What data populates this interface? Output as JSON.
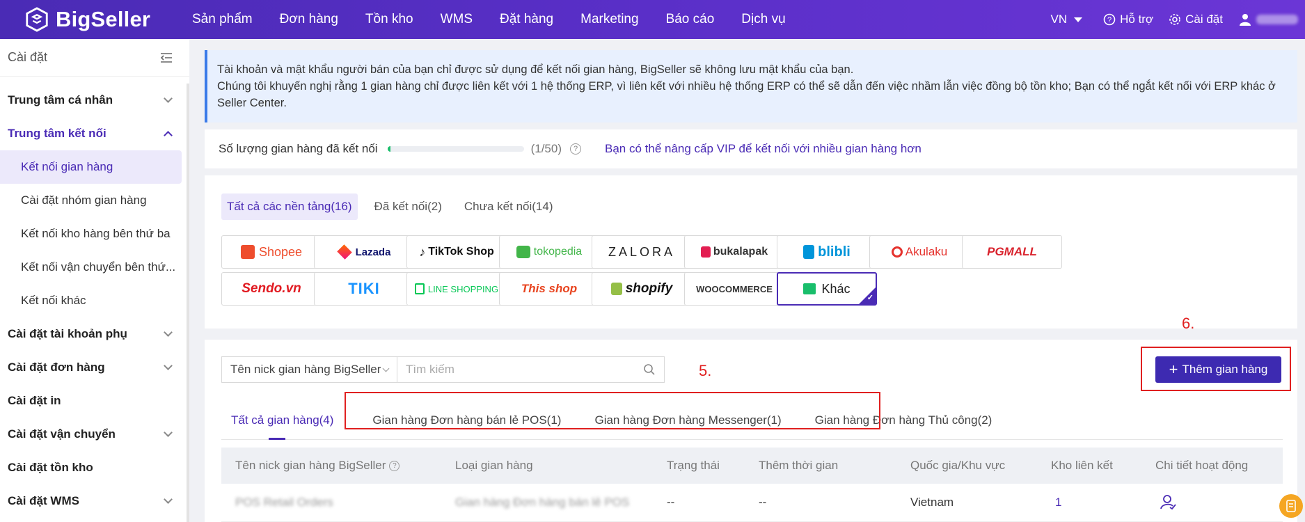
{
  "app": {
    "brand": "BigSeller",
    "accent": "#4a2bb5"
  },
  "nav": [
    "Sản phẩm",
    "Đơn hàng",
    "Tồn kho",
    "WMS",
    "Đặt hàng",
    "Marketing",
    "Báo cáo",
    "Dịch vụ"
  ],
  "topright": {
    "lang": "VN",
    "help": "Hỗ trợ",
    "settings": "Cài đặt"
  },
  "sidebar": {
    "title": "Cài đặt",
    "personal": "Trung tâm cá nhân",
    "connect": "Trung tâm kết nối",
    "sub": [
      "Kết nối gian hàng",
      "Cài đặt nhóm gian hàng",
      "Kết nối kho hàng bên thứ ba",
      "Kết nối vận chuyển bên thứ...",
      "Kết nối khác"
    ],
    "items": [
      "Cài đặt tài khoản phụ",
      "Cài đặt đơn hàng",
      "Cài đặt in",
      "Cài đặt vận chuyển",
      "Cài đặt tồn kho",
      "Cài đặt WMS"
    ]
  },
  "notice": {
    "line1": "Tài khoản và mật khẩu người bán của bạn chỉ được sử dụng để kết nối gian hàng, BigSeller sẽ không lưu mật khẩu của bạn.",
    "line2": "Chúng tôi khuyến nghị rằng 1 gian hàng chỉ được liên kết với 1 hệ thống ERP, vì liên kết với nhiều hệ thống ERP có thể sẽ dẫn đến việc nhầm lẫn việc đồng bộ tồn kho; Bạn có thể ngắt kết nối với ERP khác ở Seller Center."
  },
  "quota": {
    "label": "Số lượng gian hàng đã kết nối",
    "count": "(1/50)",
    "used": 1,
    "total": 50,
    "upgrade": "Bạn có thể nâng cấp VIP để kết nối với nhiều gian hàng hơn"
  },
  "platform_tabs": [
    "Tất cả các nền tảng(16)",
    "Đã kết nối(2)",
    "Chưa kết nối(14)"
  ],
  "platforms": [
    "Shopee",
    "Lazada",
    "TikTok Shop",
    "tokopedia",
    "ZALORA",
    "bukalapak",
    "blibli",
    "Akulaku",
    "PGMALL",
    "Sendo.vn",
    "TIKI",
    "LINE SHOPPING",
    "This shop",
    "shopify",
    "WOOCOMMERCE",
    "Khác"
  ],
  "filter": {
    "select": "Tên nick gian hàng BigSeller",
    "placeholder": "Tìm kiếm"
  },
  "annotations": {
    "a5": "5.",
    "a6": "6."
  },
  "add_button": "Thêm gian hàng",
  "store_tabs": [
    "Tất cả gian hàng(4)",
    "Gian hàng Đơn hàng bán lẻ POS(1)",
    "Gian hàng Đơn hàng Messenger(1)",
    "Gian hàng Đơn hàng Thủ công(2)"
  ],
  "table": {
    "headers": [
      "Tên nick gian hàng BigSeller",
      "Loại gian hàng",
      "Trạng thái",
      "Thêm thời gian",
      "Quốc gia/Khu vực",
      "Kho liên kết",
      "Chi tiết hoạt động"
    ],
    "rows": [
      {
        "name": "POS Retail Orders",
        "type": "Gian hàng Đơn hàng bán lẻ POS",
        "status": "--",
        "time": "--",
        "country": "Vietnam",
        "warehouse": "1"
      }
    ]
  }
}
